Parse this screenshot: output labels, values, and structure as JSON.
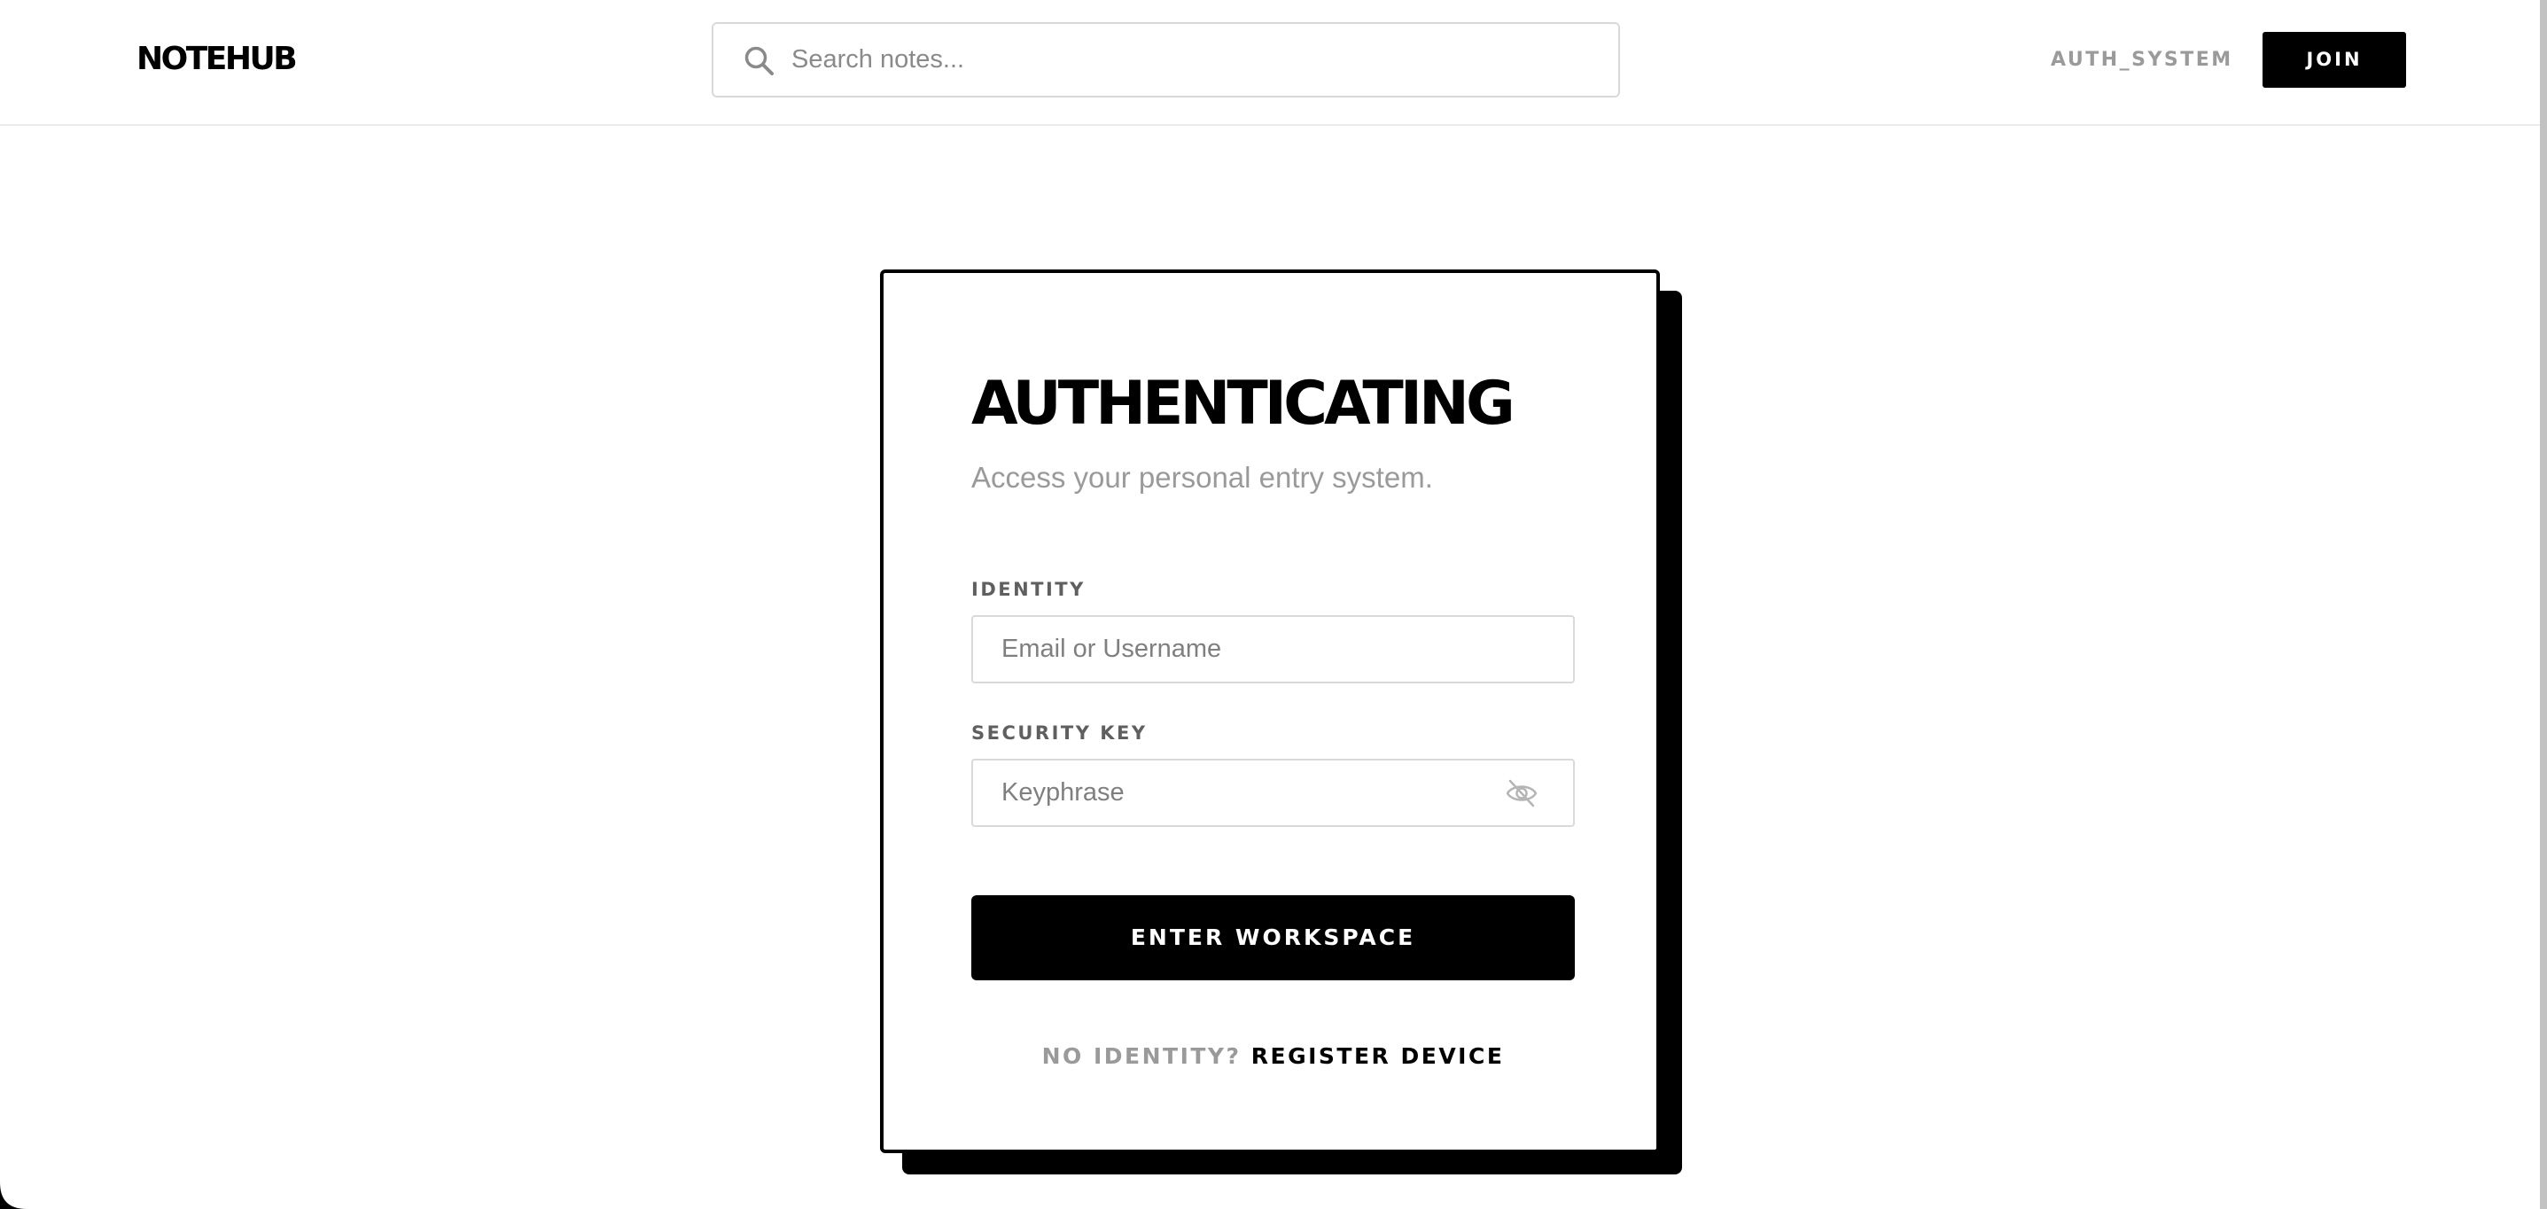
{
  "header": {
    "logo_text": "NOTEHUB",
    "search": {
      "placeholder": "Search notes...",
      "value": "",
      "icon": "search-icon"
    },
    "auth_link_label": "AUTH_SYSTEM",
    "join_label": "JOIN"
  },
  "login_card": {
    "title": "AUTHENTICATING",
    "subtitle": "Access your personal entry system.",
    "identity": {
      "label": "IDENTITY",
      "placeholder": "Email or Username",
      "value": ""
    },
    "security_key": {
      "label": "SECURITY KEY",
      "placeholder": "Keyphrase",
      "value": "",
      "toggle_icon": "eye-off-icon"
    },
    "submit_label": "ENTER WORKSPACE",
    "register_prompt": "NO IDENTITY?",
    "register_link_label": "REGISTER DEVICE"
  },
  "colors": {
    "background": "#ffffff",
    "primary": "#000000",
    "muted_text": "#9a9a9a",
    "label_text": "#5f5f5f",
    "border": "#d9d9d9"
  }
}
